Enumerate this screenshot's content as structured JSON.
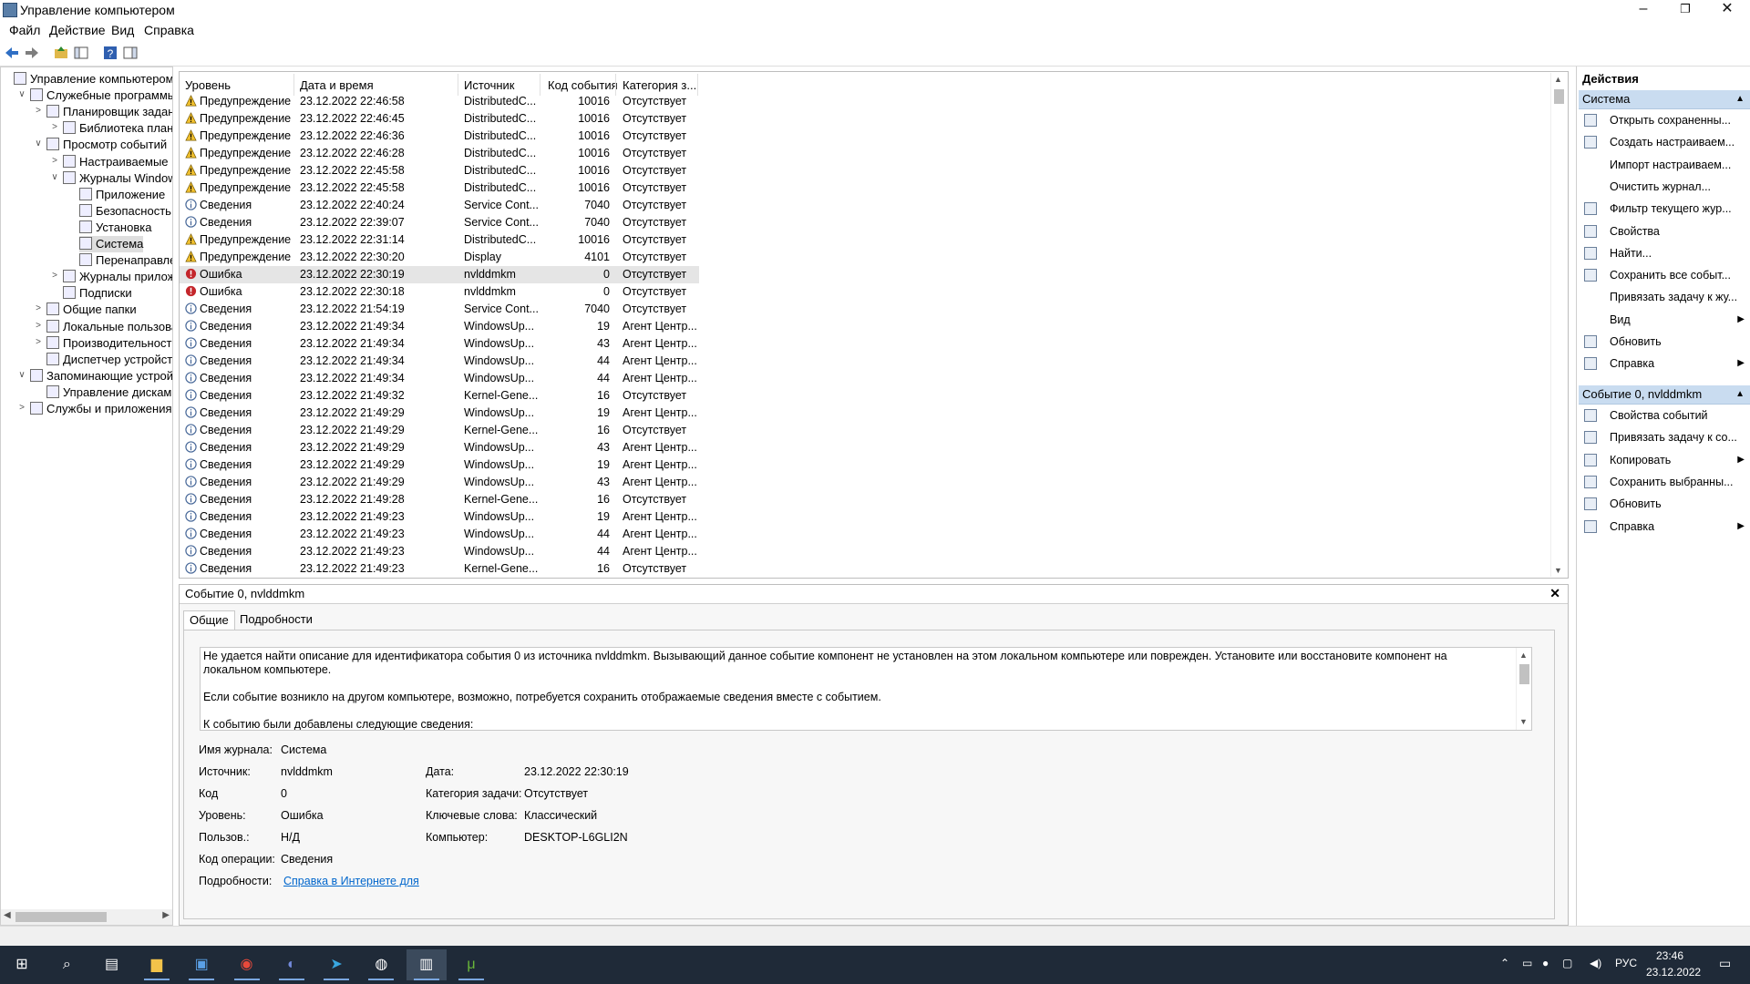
{
  "window": {
    "title": "Управление компьютером",
    "min": "–",
    "max": "❐",
    "close": "✕"
  },
  "menu": [
    "Файл",
    "Действие",
    "Вид",
    "Справка"
  ],
  "tree": [
    {
      "label": "Управление компьютером (л",
      "level": 0,
      "tw": "",
      "icon": "computer-management-icon"
    },
    {
      "label": "Служебные программы",
      "level": 1,
      "tw": "∨",
      "icon": "tools-icon"
    },
    {
      "label": "Планировщик заданий",
      "level": 2,
      "tw": ">",
      "icon": "clock-icon"
    },
    {
      "label": "Библиотека планир",
      "level": 3,
      "tw": ">",
      "icon": "folder-icon"
    },
    {
      "label": "Просмотр событий",
      "level": 2,
      "tw": "∨",
      "icon": "event-viewer-icon"
    },
    {
      "label": "Настраиваемые пр",
      "level": 3,
      "tw": ">",
      "icon": "folder-icon"
    },
    {
      "label": "Журналы Windows",
      "level": 3,
      "tw": "∨",
      "icon": "folder-icon"
    },
    {
      "label": "Приложение",
      "level": 4,
      "tw": "",
      "icon": "log-icon"
    },
    {
      "label": "Безопасность",
      "level": 4,
      "tw": "",
      "icon": "log-icon"
    },
    {
      "label": "Установка",
      "level": 4,
      "tw": "",
      "icon": "log-icon"
    },
    {
      "label": "Система",
      "level": 4,
      "tw": "",
      "icon": "log-icon",
      "selected": true
    },
    {
      "label": "Перенаправлен",
      "level": 4,
      "tw": "",
      "icon": "log-icon"
    },
    {
      "label": "Журналы приложе",
      "level": 3,
      "tw": ">",
      "icon": "folder-icon"
    },
    {
      "label": "Подписки",
      "level": 3,
      "tw": "",
      "icon": "subscriptions-icon"
    },
    {
      "label": "Общие папки",
      "level": 2,
      "tw": ">",
      "icon": "shared-folders-icon"
    },
    {
      "label": "Локальные пользовате",
      "level": 2,
      "tw": ">",
      "icon": "users-icon"
    },
    {
      "label": "Производительность",
      "level": 2,
      "tw": ">",
      "icon": "performance-icon"
    },
    {
      "label": "Диспетчер устройств",
      "level": 2,
      "tw": "",
      "icon": "device-manager-icon"
    },
    {
      "label": "Запоминающие устройст",
      "level": 1,
      "tw": "∨",
      "icon": "storage-icon"
    },
    {
      "label": "Управление дисками",
      "level": 2,
      "tw": "",
      "icon": "disk-icon"
    },
    {
      "label": "Службы и приложения",
      "level": 1,
      "tw": ">",
      "icon": "services-icon"
    }
  ],
  "columns": [
    "Уровень",
    "Дата и время",
    "Источник",
    "Код события",
    "Категория з..."
  ],
  "events": [
    {
      "level": "Предупреждение",
      "type": "warn",
      "date": "23.12.2022 22:46:58",
      "source": "DistributedC...",
      "code": "10016",
      "cat": "Отсутствует"
    },
    {
      "level": "Предупреждение",
      "type": "warn",
      "date": "23.12.2022 22:46:45",
      "source": "DistributedC...",
      "code": "10016",
      "cat": "Отсутствует"
    },
    {
      "level": "Предупреждение",
      "type": "warn",
      "date": "23.12.2022 22:46:36",
      "source": "DistributedC...",
      "code": "10016",
      "cat": "Отсутствует"
    },
    {
      "level": "Предупреждение",
      "type": "warn",
      "date": "23.12.2022 22:46:28",
      "source": "DistributedC...",
      "code": "10016",
      "cat": "Отсутствует"
    },
    {
      "level": "Предупреждение",
      "type": "warn",
      "date": "23.12.2022 22:45:58",
      "source": "DistributedC...",
      "code": "10016",
      "cat": "Отсутствует"
    },
    {
      "level": "Предупреждение",
      "type": "warn",
      "date": "23.12.2022 22:45:58",
      "source": "DistributedC...",
      "code": "10016",
      "cat": "Отсутствует"
    },
    {
      "level": "Сведения",
      "type": "info",
      "date": "23.12.2022 22:40:24",
      "source": "Service Cont...",
      "code": "7040",
      "cat": "Отсутствует"
    },
    {
      "level": "Сведения",
      "type": "info",
      "date": "23.12.2022 22:39:07",
      "source": "Service Cont...",
      "code": "7040",
      "cat": "Отсутствует"
    },
    {
      "level": "Предупреждение",
      "type": "warn",
      "date": "23.12.2022 22:31:14",
      "source": "DistributedC...",
      "code": "10016",
      "cat": "Отсутствует"
    },
    {
      "level": "Предупреждение",
      "type": "warn",
      "date": "23.12.2022 22:30:20",
      "source": "Display",
      "code": "4101",
      "cat": "Отсутствует"
    },
    {
      "level": "Ошибка",
      "type": "err",
      "date": "23.12.2022 22:30:19",
      "source": "nvlddmkm",
      "code": "0",
      "cat": "Отсутствует",
      "selected": true
    },
    {
      "level": "Ошибка",
      "type": "err",
      "date": "23.12.2022 22:30:18",
      "source": "nvlddmkm",
      "code": "0",
      "cat": "Отсутствует"
    },
    {
      "level": "Сведения",
      "type": "info",
      "date": "23.12.2022 21:54:19",
      "source": "Service Cont...",
      "code": "7040",
      "cat": "Отсутствует"
    },
    {
      "level": "Сведения",
      "type": "info",
      "date": "23.12.2022 21:49:34",
      "source": "WindowsUp...",
      "code": "19",
      "cat": "Агент Центр..."
    },
    {
      "level": "Сведения",
      "type": "info",
      "date": "23.12.2022 21:49:34",
      "source": "WindowsUp...",
      "code": "43",
      "cat": "Агент Центр..."
    },
    {
      "level": "Сведения",
      "type": "info",
      "date": "23.12.2022 21:49:34",
      "source": "WindowsUp...",
      "code": "44",
      "cat": "Агент Центр..."
    },
    {
      "level": "Сведения",
      "type": "info",
      "date": "23.12.2022 21:49:34",
      "source": "WindowsUp...",
      "code": "44",
      "cat": "Агент Центр..."
    },
    {
      "level": "Сведения",
      "type": "info",
      "date": "23.12.2022 21:49:32",
      "source": "Kernel-Gene...",
      "code": "16",
      "cat": "Отсутствует"
    },
    {
      "level": "Сведения",
      "type": "info",
      "date": "23.12.2022 21:49:29",
      "source": "WindowsUp...",
      "code": "19",
      "cat": "Агент Центр..."
    },
    {
      "level": "Сведения",
      "type": "info",
      "date": "23.12.2022 21:49:29",
      "source": "Kernel-Gene...",
      "code": "16",
      "cat": "Отсутствует"
    },
    {
      "level": "Сведения",
      "type": "info",
      "date": "23.12.2022 21:49:29",
      "source": "WindowsUp...",
      "code": "43",
      "cat": "Агент Центр..."
    },
    {
      "level": "Сведения",
      "type": "info",
      "date": "23.12.2022 21:49:29",
      "source": "WindowsUp...",
      "code": "19",
      "cat": "Агент Центр..."
    },
    {
      "level": "Сведения",
      "type": "info",
      "date": "23.12.2022 21:49:29",
      "source": "WindowsUp...",
      "code": "43",
      "cat": "Агент Центр..."
    },
    {
      "level": "Сведения",
      "type": "info",
      "date": "23.12.2022 21:49:28",
      "source": "Kernel-Gene...",
      "code": "16",
      "cat": "Отсутствует"
    },
    {
      "level": "Сведения",
      "type": "info",
      "date": "23.12.2022 21:49:23",
      "source": "WindowsUp...",
      "code": "19",
      "cat": "Агент Центр..."
    },
    {
      "level": "Сведения",
      "type": "info",
      "date": "23.12.2022 21:49:23",
      "source": "WindowsUp...",
      "code": "44",
      "cat": "Агент Центр..."
    },
    {
      "level": "Сведения",
      "type": "info",
      "date": "23.12.2022 21:49:23",
      "source": "WindowsUp...",
      "code": "44",
      "cat": "Агент Центр..."
    },
    {
      "level": "Сведения",
      "type": "info",
      "date": "23.12.2022 21:49:23",
      "source": "Kernel-Gene...",
      "code": "16",
      "cat": "Отсутствует"
    }
  ],
  "detail": {
    "header": "Событие 0, nvlddmkm",
    "close": "✕",
    "tabs": [
      "Общие",
      "Подробности"
    ],
    "description": [
      "Не удается найти описание для идентификатора события 0 из источника nvlddmkm. Вызывающий данное событие компонент не установлен на этом локальном компьютере или поврежден. Установите или восстановите компонент на локальном компьютере.",
      "Если событие возникло на другом компьютере, возможно, потребуется сохранить отображаемые сведения вместе с событием.",
      "К событию были добавлены следующие сведения:"
    ],
    "fields": {
      "log_name_label": "Имя журнала:",
      "log_name": "Система",
      "source_label": "Источник:",
      "source": "nvlddmkm",
      "date_label": "Дата:",
      "date": "23.12.2022 22:30:19",
      "code_label": "Код",
      "code": "0",
      "task_cat_label": "Категория задачи:",
      "task_cat": "Отсутствует",
      "level_label": "Уровень:",
      "level": "Ошибка",
      "keywords_label": "Ключевые слова:",
      "keywords": "Классический",
      "user_label": "Пользов.:",
      "user": "Н/Д",
      "computer_label": "Компьютер:",
      "computer": "DESKTOP-L6GLI2N",
      "opcode_label": "Код операции:",
      "opcode": "Сведения",
      "more_label": "Подробности:",
      "more_link": "Справка в Интернете для "
    }
  },
  "actions": {
    "title": "Действия",
    "section1": "Система",
    "items1": [
      {
        "label": "Открыть сохраненны...",
        "icon": "open-folder-icon",
        "arrow": false
      },
      {
        "label": "Создать настраиваем...",
        "icon": "filter-create-icon",
        "arrow": false
      },
      {
        "label": "Импорт настраиваем...",
        "icon": "",
        "arrow": false
      },
      {
        "label": "Очистить журнал...",
        "icon": "",
        "arrow": false
      },
      {
        "label": "Фильтр текущего жур...",
        "icon": "filter-icon",
        "arrow": false
      },
      {
        "label": "Свойства",
        "icon": "properties-icon",
        "arrow": false
      },
      {
        "label": "Найти...",
        "icon": "find-icon",
        "arrow": false
      },
      {
        "label": "Сохранить все событ...",
        "icon": "save-icon",
        "arrow": false
      },
      {
        "label": "Привязать задачу к жу...",
        "icon": "",
        "arrow": false
      },
      {
        "label": "Вид",
        "icon": "",
        "arrow": true
      },
      {
        "label": "Обновить",
        "icon": "refresh-icon",
        "arrow": false
      },
      {
        "label": "Справка",
        "icon": "help-icon",
        "arrow": true
      }
    ],
    "section2": "Событие 0, nvlddmkm",
    "items2": [
      {
        "label": "Свойства событий",
        "icon": "event-properties-icon",
        "arrow": false
      },
      {
        "label": "Привязать задачу к со...",
        "icon": "attach-task-icon",
        "arrow": false
      },
      {
        "label": "Копировать",
        "icon": "copy-icon",
        "arrow": true
      },
      {
        "label": "Сохранить выбранны...",
        "icon": "save-icon",
        "arrow": false
      },
      {
        "label": "Обновить",
        "icon": "refresh-icon",
        "arrow": false
      },
      {
        "label": "Справка",
        "icon": "help-icon",
        "arrow": true
      }
    ]
  },
  "taskbar": {
    "apps": [
      "start-icon",
      "search-icon",
      "task-view-icon",
      "file-explorer-icon",
      "store-icon",
      "chrome-icon",
      "discord-icon",
      "telegram-icon",
      "steam-icon",
      "computer-management-icon",
      "utorrent-icon"
    ],
    "lang": "РУС",
    "time": "23:46",
    "date": "23.12.2022"
  },
  "colors": {
    "accent": "#c9dcf0",
    "warn": "#f2c12e",
    "error": "#c4262b",
    "info": "#4a6a9a",
    "taskbar": "#1f2a38",
    "link": "#0066cc"
  }
}
